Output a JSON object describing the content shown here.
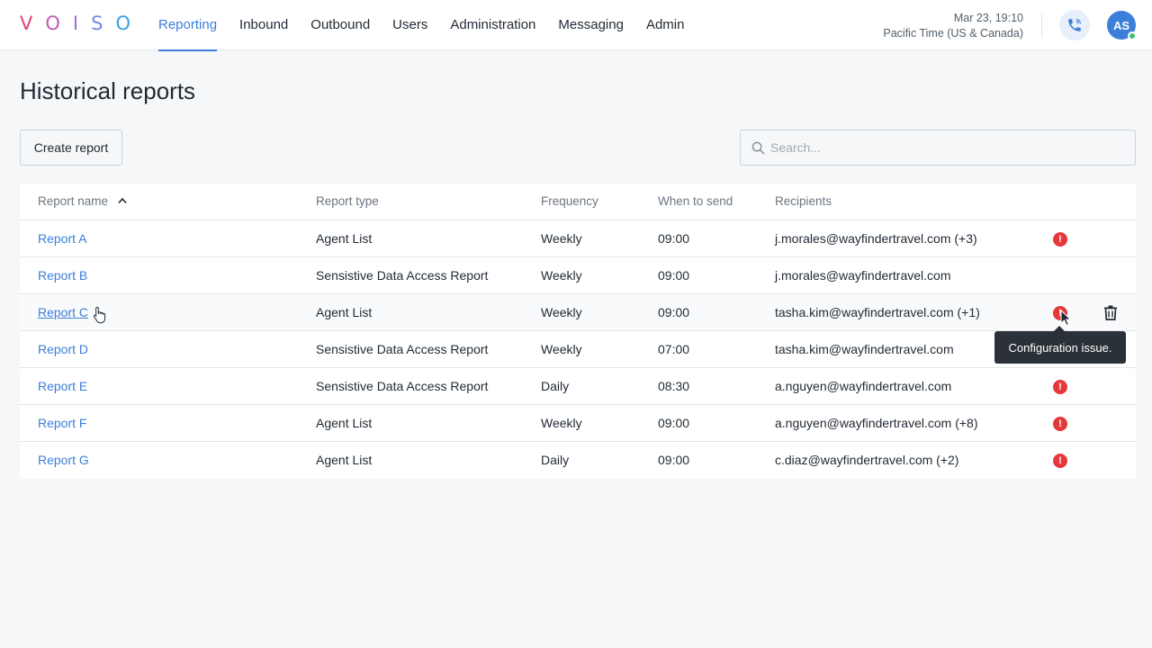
{
  "logo": {
    "letters": [
      "V",
      "O",
      "I",
      "S",
      "O"
    ],
    "colors": [
      "#e2427d",
      "#c25bb5",
      "#9b6fd6",
      "#6f8fe2",
      "#3b9fe8"
    ]
  },
  "nav": {
    "items": [
      {
        "label": "Reporting",
        "active": true
      },
      {
        "label": "Inbound"
      },
      {
        "label": "Outbound"
      },
      {
        "label": "Users"
      },
      {
        "label": "Administration"
      },
      {
        "label": "Messaging"
      },
      {
        "label": "Admin"
      }
    ]
  },
  "header": {
    "datetime": "Mar 23, 19:10",
    "timezone": "Pacific Time (US & Canada)",
    "phone_icon": "phone-icon",
    "avatar_initials": "AS",
    "presence_color": "#3fbf6a"
  },
  "page": {
    "title": "Historical reports",
    "create_button": "Create report",
    "search_placeholder": "Search..."
  },
  "table": {
    "columns": [
      "Report name",
      "Report type",
      "Frequency",
      "When to send",
      "Recipients"
    ],
    "sort": {
      "column": "Report name",
      "direction": "ascending"
    },
    "rows": [
      {
        "name": "Report A",
        "type": "Agent List",
        "frequency": "Weekly",
        "when": "09:00",
        "recipients": "j.morales@wayfindertravel.com (+3)",
        "warning": true
      },
      {
        "name": "Report B",
        "type": "Sensistive Data Access Report",
        "frequency": "Weekly",
        "when": "09:00",
        "recipients": "j.morales@wayfindertravel.com",
        "warning": false
      },
      {
        "name": "Report C",
        "type": "Agent List",
        "frequency": "Weekly",
        "when": "09:00",
        "recipients": "tasha.kim@wayfindertravel.com (+1)",
        "warning": true,
        "hover": true
      },
      {
        "name": "Report D",
        "type": "Sensistive Data Access Report",
        "frequency": "Weekly",
        "when": "07:00",
        "recipients": "tasha.kim@wayfindertravel.com",
        "warning": false
      },
      {
        "name": "Report E",
        "type": "Sensistive Data Access Report",
        "frequency": "Daily",
        "when": "08:30",
        "recipients": "a.nguyen@wayfindertravel.com",
        "warning": true
      },
      {
        "name": "Report F",
        "type": "Agent List",
        "frequency": "Weekly",
        "when": "09:00",
        "recipients": "a.nguyen@wayfindertravel.com (+8)",
        "warning": true
      },
      {
        "name": "Report G",
        "type": "Agent List",
        "frequency": "Daily",
        "when": "09:00",
        "recipients": "c.diaz@wayfindertravel.com (+2)",
        "warning": true
      }
    ]
  },
  "tooltip": {
    "text": "Configuration issue."
  },
  "colors": {
    "accent": "#3b7fd9",
    "warning": "#e5383b",
    "tooltip_bg": "#2b3138"
  }
}
